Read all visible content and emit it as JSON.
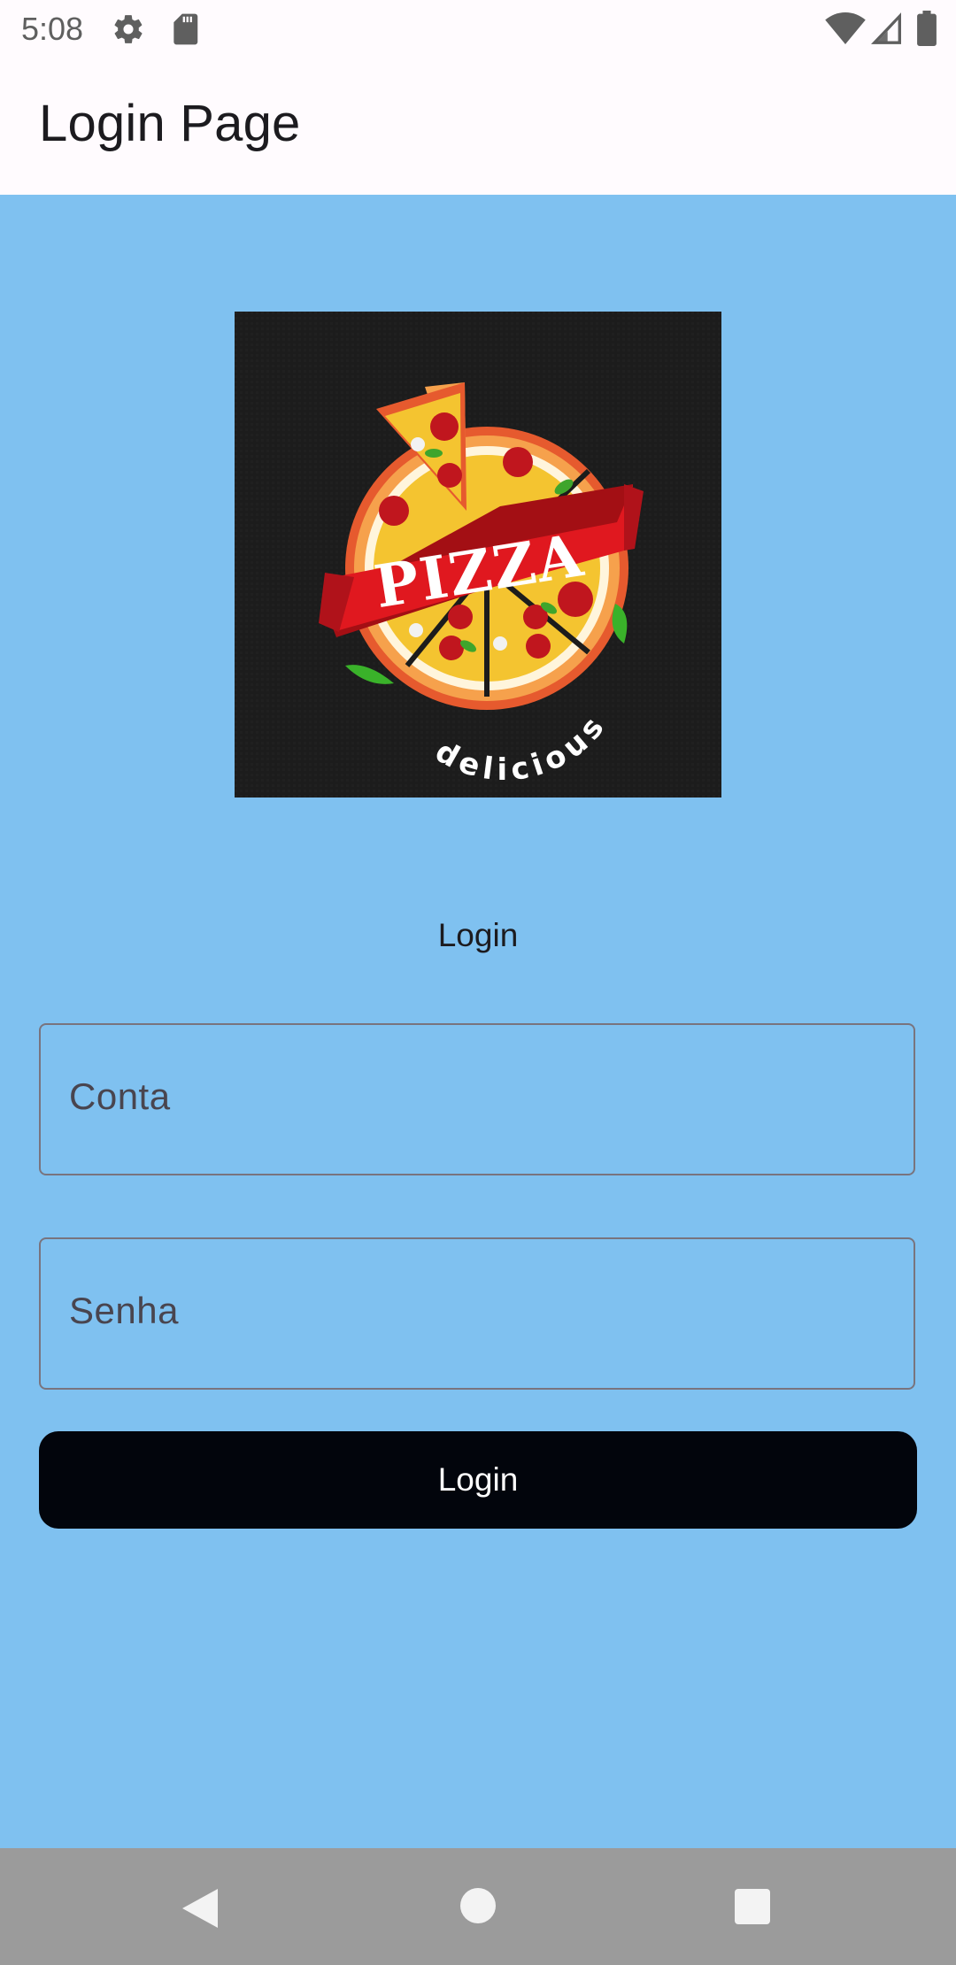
{
  "status_bar": {
    "time": "5:08",
    "icons": [
      "gear-icon",
      "sdcard-icon",
      "wifi-icon",
      "signal-icon",
      "battery-icon"
    ]
  },
  "app_bar": {
    "title": "Login Page"
  },
  "logo": {
    "brand": "PIZZA",
    "tagline": "delicious",
    "background": "#1c1c1c"
  },
  "form": {
    "heading": "Login",
    "account_field": {
      "placeholder": "Conta",
      "value": ""
    },
    "password_field": {
      "placeholder": "Senha",
      "value": ""
    },
    "submit_label": "Login"
  },
  "nav_bar": {
    "icons": [
      "back-icon",
      "home-icon",
      "recents-icon"
    ]
  },
  "colors": {
    "page_background": "#7fc1f0",
    "app_bar_background": "#fffbfe",
    "button_background": "#02050c",
    "nav_bar_background": "#9b9b9b"
  }
}
